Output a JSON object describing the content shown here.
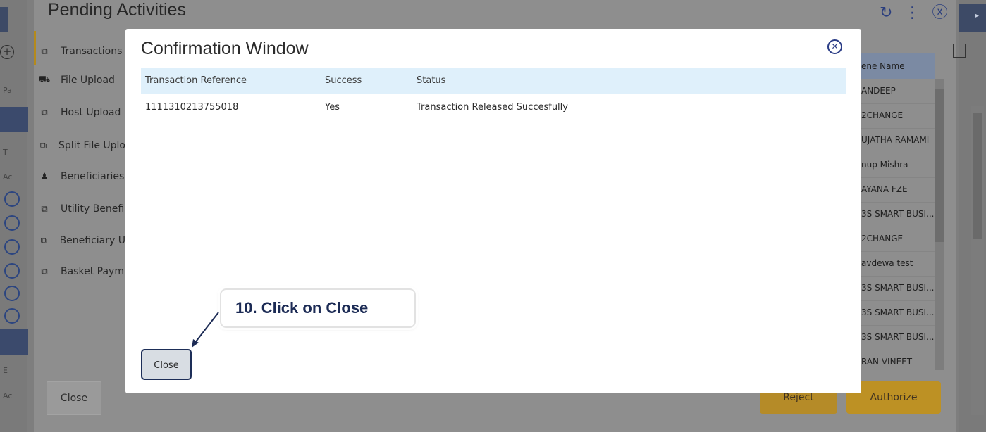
{
  "background": {
    "page_title": "Pending Activities",
    "header_icons": [
      "refresh-icon",
      "more-icon",
      "close-circle-icon"
    ],
    "nav_items": [
      {
        "label": "Transactions",
        "icon": "transactions-icon"
      },
      {
        "label": "File Upload",
        "icon": "file-upload-icon"
      },
      {
        "label": "Host Upload",
        "icon": "host-upload-icon"
      },
      {
        "label": "Split File Uplo",
        "icon": "split-file-icon"
      },
      {
        "label": "Beneficiaries",
        "icon": "beneficiaries-icon"
      },
      {
        "label": "Utility Benefi",
        "icon": "utility-icon"
      },
      {
        "label": "Beneficiary U",
        "icon": "beneficiary-upload-icon"
      },
      {
        "label": "Basket Paym",
        "icon": "basket-payment-icon"
      }
    ],
    "edge_labels": [
      "Pa",
      "T",
      "Ac",
      "E",
      "Ac"
    ],
    "bene_header": "ene Name",
    "bene_rows": [
      "ANDEEP",
      "2CHANGE",
      "UJATHA RAMAMI",
      "nup Mishra",
      "AYANA FZE",
      "3S SMART BUSI...",
      "2CHANGE",
      "avdewa test",
      "3S SMART BUSI...",
      "3S SMART BUSI...",
      "3S SMART BUSI...",
      "RAN VINEET"
    ],
    "close_label": "Close",
    "reject_label": "Reject",
    "authorize_label": "Authorize"
  },
  "modal": {
    "title": "Confirmation Window",
    "columns": [
      "Transaction Reference",
      "Success",
      "Status"
    ],
    "rows": [
      {
        "reference": "1111310213755018",
        "success": "Yes",
        "status": "Transaction Released Succesfully"
      }
    ],
    "close_label": "Close"
  },
  "callout": {
    "text": "10.  Click on Close"
  },
  "colors": {
    "accent": "#2a3c86",
    "header_bg": "#dff0fb",
    "gold": "#bd9124",
    "callout_text": "#1c2b55"
  }
}
